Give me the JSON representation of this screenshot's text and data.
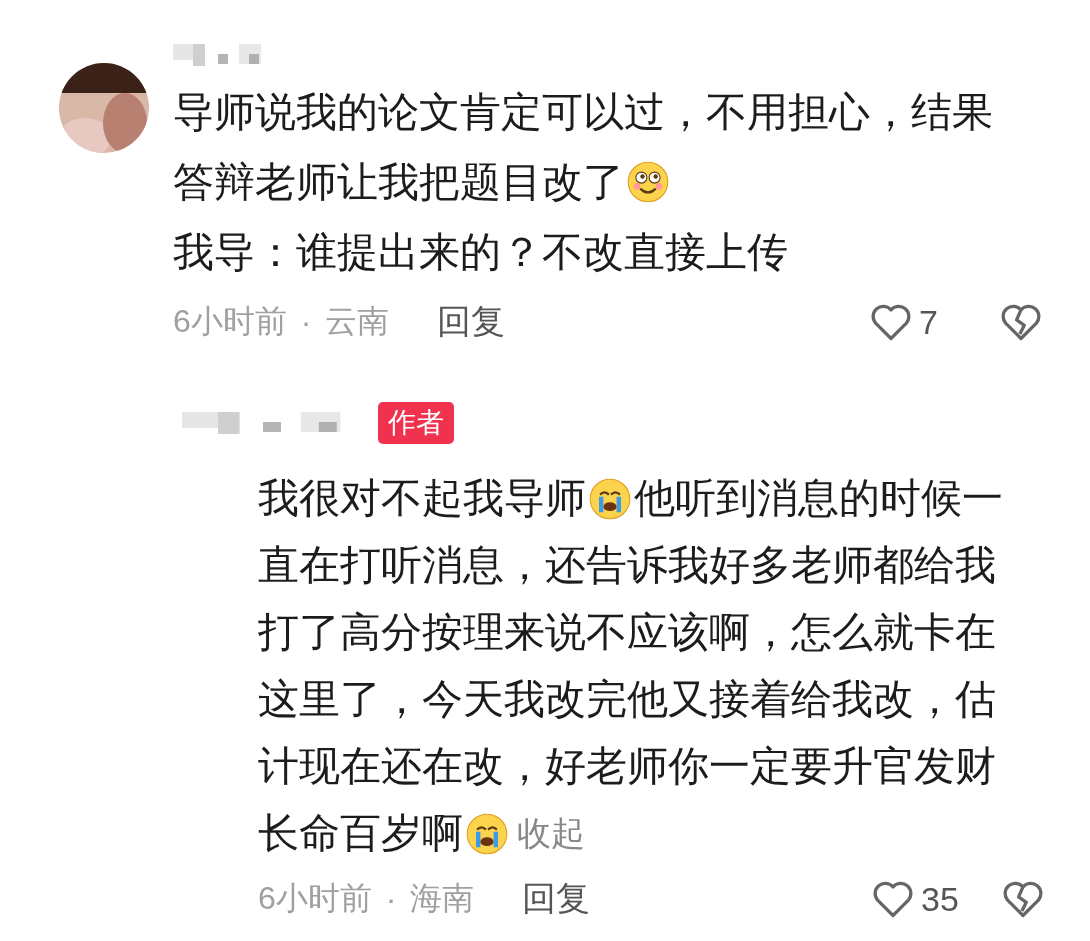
{
  "comment": {
    "lines": [
      [
        {
          "kind": "text",
          "text": "导师说我的论文肯定可以过，不用担心，结果"
        }
      ],
      [
        {
          "kind": "text",
          "text": "答辩老师让我把题目改了"
        },
        {
          "kind": "smile"
        }
      ],
      [
        {
          "kind": "text",
          "text": "我导：谁提出来的？不改直接上传"
        }
      ]
    ],
    "time": "6小时前",
    "separator": "·",
    "location": "云南",
    "reply": "回复",
    "likes": "7"
  },
  "reply": {
    "badge": "作者",
    "lines": [
      [
        {
          "kind": "text",
          "text": "我很对不起我导师"
        },
        {
          "kind": "cry"
        },
        {
          "kind": "text",
          "text": "他听到消息的时候一"
        }
      ],
      [
        {
          "kind": "text",
          "text": "直在打听消息，还告诉我好多老师都给我"
        }
      ],
      [
        {
          "kind": "text",
          "text": "打了高分按理来说不应该啊，怎么就卡在"
        }
      ],
      [
        {
          "kind": "text",
          "text": "这里了，今天我改完他又接着给我改，估"
        }
      ],
      [
        {
          "kind": "text",
          "text": "计现在还在改，好老师你一定要升官发财"
        }
      ],
      [
        {
          "kind": "text",
          "text": "长命百岁啊"
        },
        {
          "kind": "cry"
        },
        {
          "kind": "link",
          "text": "收起"
        }
      ]
    ],
    "time": "6小时前",
    "separator": "·",
    "location": "海南",
    "reply": "回复",
    "likes": "35"
  }
}
